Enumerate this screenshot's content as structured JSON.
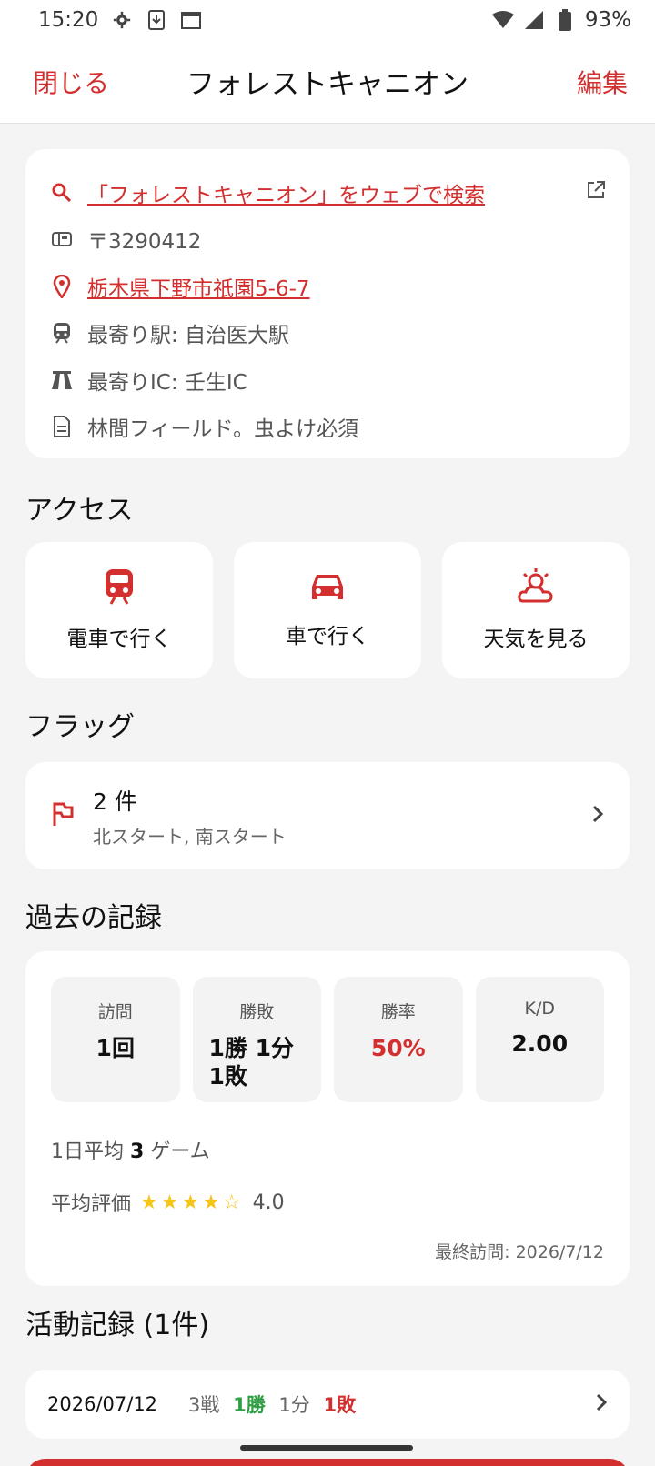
{
  "status_bar": {
    "time": "15:20",
    "icons": [
      "gear-icon",
      "download-icon",
      "calendar-icon"
    ],
    "battery": "93%",
    "signal_icons": [
      "wifi-icon",
      "cell-signal-icon",
      "battery-icon"
    ]
  },
  "header": {
    "close_label": "閉じる",
    "title": "フォレストキャニオン",
    "edit_label": "編集"
  },
  "info": {
    "search_link": "「フォレストキャニオン」をウェブで検索",
    "postal": "〒3290412",
    "address": "栃木県下野市祇園5-6-7",
    "station": "最寄り駅: 自治医大駅",
    "ic": "最寄りIC: 壬生IC",
    "note": "林間フィールド。虫よけ必須"
  },
  "access": {
    "title": "アクセス",
    "items": [
      {
        "label": "電車で行く",
        "icon": "train-icon"
      },
      {
        "label": "車で行く",
        "icon": "car-icon"
      },
      {
        "label": "天気を見る",
        "icon": "weather-icon"
      }
    ]
  },
  "flags": {
    "title": "フラッグ",
    "count": "2 件",
    "names": "北スタート, 南スタート"
  },
  "records": {
    "title": "過去の記録",
    "stats": [
      {
        "label": "訪問",
        "value": "1回"
      },
      {
        "label": "勝敗",
        "value": "1勝 1分\n1敗"
      },
      {
        "label": "勝率",
        "value": "50%"
      },
      {
        "label": "K/D",
        "value": "2.00"
      }
    ],
    "avg_prefix": "1日平均",
    "avg_value": "3",
    "avg_suffix": "ゲーム",
    "rating_label": "平均評価",
    "rating_stars": "★★★★☆",
    "rating_value": "4.0",
    "last_visit": "最終訪問: 2026/7/12"
  },
  "activity": {
    "title": "活動記録 (1件)",
    "rows": [
      {
        "date": "2026/07/12",
        "battles": "3戦",
        "wins": "1勝",
        "draws": "1分",
        "losses": "1敗"
      }
    ]
  },
  "colors": {
    "accent": "#d32f2f",
    "win": "#2ea043",
    "star": "#f5c518"
  }
}
